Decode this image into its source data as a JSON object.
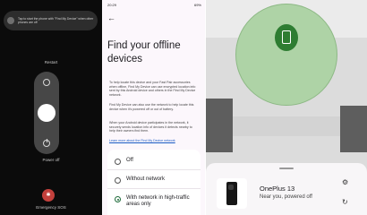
{
  "power_menu": {
    "toast": "Tap to start the phone with \"Find My Device\" when other phones are off",
    "restart_label": "Restart",
    "power_off_label": "Power off",
    "sos_label": "Emergency SOS"
  },
  "settings": {
    "status_time": "20:29",
    "status_right": "69%",
    "title": "Find your offline devices",
    "para1": "To help locate this device and your Fast Pair accessories when offline, Find My Device can use encrypted location info sent by this Android device and others in the Find My Device network.",
    "para2": "Find My Device can also use the network to help locate this device when it's powered off or out of battery.",
    "para3": "When your Android device participates in the network, it securely sends location info of devices it detects nearby to help their owners find them.",
    "link": "Learn more about the Find My Device network",
    "options": [
      {
        "label": "Off",
        "selected": false
      },
      {
        "label": "Without network",
        "selected": false
      },
      {
        "label": "With network in high-traffic areas only",
        "selected": true
      }
    ]
  },
  "finder": {
    "device_name": "OnePlus 13",
    "device_status": "Near you, powered off",
    "icons": [
      "settings-gear-icon",
      "refresh-icon",
      "phone-pin-icon"
    ]
  }
}
